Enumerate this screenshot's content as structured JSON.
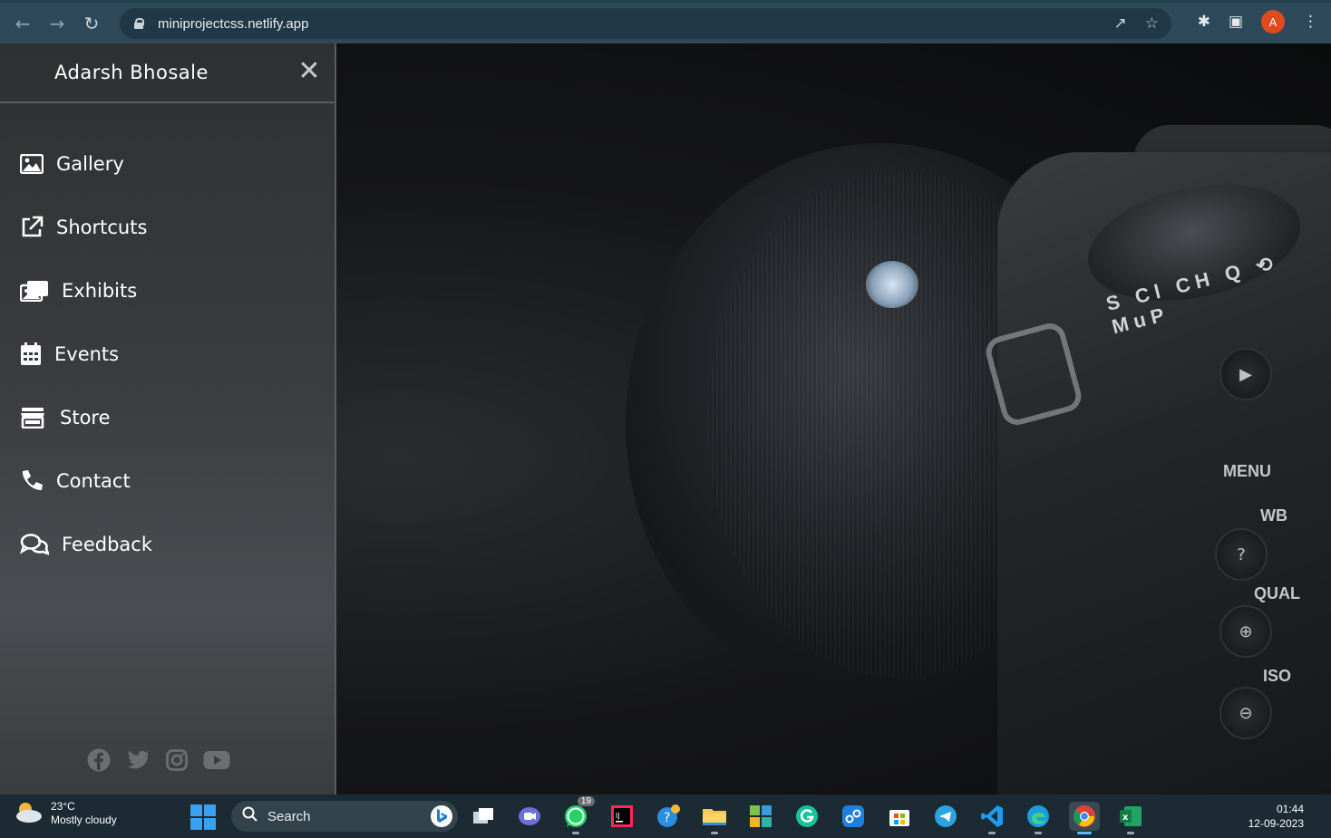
{
  "browser": {
    "url": "miniprojectcss.netlify.app",
    "profile_initial": "A"
  },
  "sidebar": {
    "title": "Adarsh Bhosale",
    "close_icon": "close-icon",
    "items": [
      {
        "label": "Gallery",
        "icon": "image-icon"
      },
      {
        "label": "Shortcuts",
        "icon": "external-link-icon"
      },
      {
        "label": "Exhibits",
        "icon": "images-icon"
      },
      {
        "label": "Events",
        "icon": "calendar-icon"
      },
      {
        "label": "Store",
        "icon": "store-icon"
      },
      {
        "label": "Contact",
        "icon": "phone-icon"
      },
      {
        "label": "Feedback",
        "icon": "comments-icon"
      }
    ],
    "social": [
      "facebook-icon",
      "twitter-icon",
      "instagram-icon",
      "youtube-icon"
    ]
  },
  "camera_labels": {
    "dial": "S Cl CH Q ⟲ MuP",
    "menu": "MENU",
    "wb": "WB",
    "qual": "QUAL",
    "iso": "ISO"
  },
  "taskbar": {
    "weather_temp": "23°C",
    "weather_desc": "Mostly cloudy",
    "search_label": "Search",
    "whatsapp_badge": "19",
    "time": "01:44",
    "date": "12-09-2023"
  },
  "colors": {
    "chrome": "#2e4a5a",
    "sidebar": "#3a3c3f",
    "taskbar": "#1c2a33",
    "accent": "#62b5ff"
  }
}
